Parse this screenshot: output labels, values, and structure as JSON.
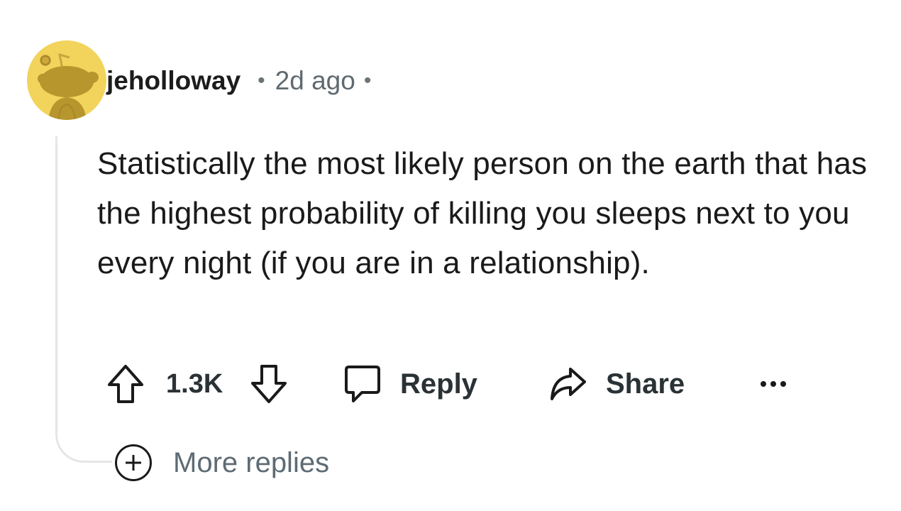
{
  "comment": {
    "username": "jeholloway",
    "separator": "•",
    "time": "2d ago",
    "body": "Statistically the most likely person on the earth that has the highest probability of killing you sleeps next to you every night (if you are in a relationship).",
    "score": "1.3K",
    "reply_label": "Reply",
    "share_label": "Share",
    "more_replies_label": "More replies"
  },
  "icons": {
    "avatar": "snoo-avatar-icon",
    "upvote": "arrow-up-icon",
    "downvote": "arrow-down-icon",
    "reply": "speech-bubble-icon",
    "share": "share-arrow-icon",
    "more": "ellipsis-icon",
    "expand": "plus-circle-icon"
  },
  "colors": {
    "avatar_bg": "#f2d45c",
    "text": "#1a1a1b",
    "meta_text": "#5f6a70",
    "thread_line": "#e4e6e8"
  }
}
